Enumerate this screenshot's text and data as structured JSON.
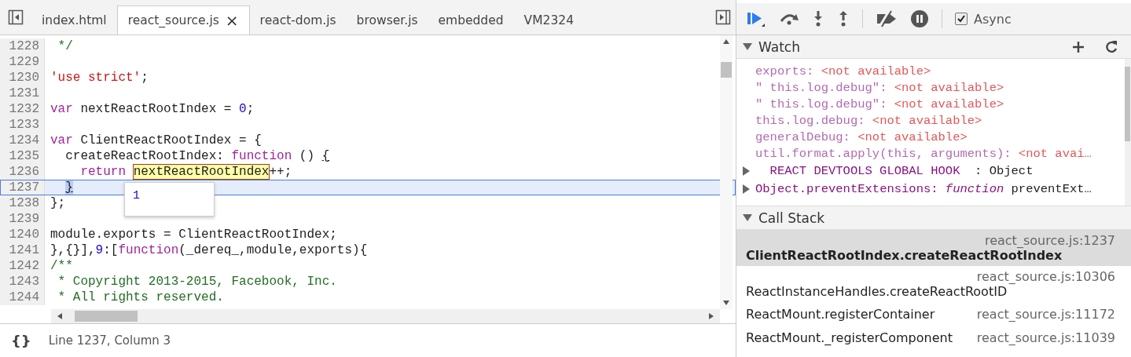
{
  "tabs": [
    {
      "label": "index.html",
      "selected": false,
      "closable": false
    },
    {
      "label": "react_source.js",
      "selected": true,
      "closable": true
    },
    {
      "label": "react-dom.js",
      "selected": false,
      "closable": false
    },
    {
      "label": "browser.js",
      "selected": false,
      "closable": false
    },
    {
      "label": "embedded",
      "selected": false,
      "closable": false
    },
    {
      "label": "VM2324",
      "selected": false,
      "closable": false
    }
  ],
  "close_glyph": "×",
  "editor": {
    "lines": [
      {
        "number": "1228",
        "current": false,
        "tokens": [
          {
            "kind": "comment",
            "text": " */"
          }
        ]
      },
      {
        "number": "1229",
        "current": false
      },
      {
        "number": "1230",
        "current": false,
        "tokens": [
          {
            "kind": "string",
            "text": "'use strict'"
          },
          {
            "kind": "plain",
            "text": ";"
          }
        ]
      },
      {
        "number": "1231",
        "current": false
      },
      {
        "number": "1232",
        "current": false,
        "tokens": [
          {
            "kind": "keyword",
            "text": "var"
          },
          {
            "kind": "plain",
            "text": " nextReactRootIndex = "
          },
          {
            "kind": "number",
            "text": "0"
          },
          {
            "kind": "plain",
            "text": ";"
          }
        ]
      },
      {
        "number": "1233",
        "current": false
      },
      {
        "number": "1234",
        "current": false,
        "tokens": [
          {
            "kind": "keyword",
            "text": "var"
          },
          {
            "kind": "plain",
            "text": " ClientReactRootIndex = {"
          }
        ]
      },
      {
        "number": "1235",
        "current": false,
        "tokens": [
          {
            "kind": "plain",
            "text": "  createReactRootIndex: "
          },
          {
            "kind": "keyword",
            "text": "function"
          },
          {
            "kind": "plain",
            "text": " () "
          },
          {
            "kind": "brace",
            "text": "{"
          }
        ]
      },
      {
        "number": "1236",
        "current": false,
        "tokens": [
          {
            "kind": "keyword",
            "text": "    return "
          },
          {
            "kind": "hovered",
            "text": "nextReactRootIndex"
          },
          {
            "kind": "plain",
            "text": "++;"
          }
        ]
      },
      {
        "number": "1237",
        "current": true,
        "indented": true,
        "tokens": [
          {
            "kind": "brace",
            "text": "}"
          }
        ]
      },
      {
        "number": "1238",
        "current": false,
        "tokens": [
          {
            "kind": "plain",
            "text": "};"
          }
        ]
      },
      {
        "number": "1239",
        "current": false
      },
      {
        "number": "1240",
        "current": false,
        "tokens": [
          {
            "kind": "plain",
            "text": "module.exports = ClientReactRootIndex;"
          }
        ]
      },
      {
        "number": "1241",
        "current": false,
        "tokens": [
          {
            "kind": "plain",
            "text": "},{}],"
          },
          {
            "kind": "number",
            "text": "9"
          },
          {
            "kind": "plain",
            "text": ":["
          },
          {
            "kind": "keyword",
            "text": "function"
          },
          {
            "kind": "plain",
            "text": "(_dereq_,module,exports){"
          }
        ]
      },
      {
        "number": "1242",
        "current": false,
        "tokens": [
          {
            "kind": "comment",
            "text": "/**"
          }
        ]
      },
      {
        "number": "1243",
        "current": false,
        "tokens": [
          {
            "kind": "comment",
            "text": " * Copyright 2013-2015, Facebook, Inc."
          }
        ]
      },
      {
        "number": "1244",
        "current": false,
        "tokens": [
          {
            "kind": "comment",
            "text": " * All rights reserved."
          }
        ]
      }
    ],
    "tooltip": "1"
  },
  "status_bar": {
    "pretty_print": "{}",
    "position": "Line 1237, Column 3"
  },
  "async": {
    "label": "Async",
    "checked": true
  },
  "watch": {
    "title": "Watch",
    "expanded": true,
    "items": [
      {
        "kind": "unavailable",
        "name": "exports:",
        "value": "<not available>"
      },
      {
        "kind": "unavailable",
        "name": "\" this.log.debug\":",
        "value": "<not available>"
      },
      {
        "kind": "unavailable",
        "name": "\" this.log.debug\":",
        "value": "<not available>"
      },
      {
        "kind": "unavailable",
        "name": "this.log.debug:",
        "value": "<not available>"
      },
      {
        "kind": "unavailable",
        "name": "generalDebug:",
        "value": "<not available>"
      },
      {
        "kind": "unavailable",
        "name": "util.format.apply(this, arguments):",
        "value": "<not avai…"
      },
      {
        "kind": "object",
        "name": "REACT DEVTOOLS GLOBAL HOOK",
        "value": ": Object"
      },
      {
        "kind": "function",
        "name": "Object.preventExtensions:",
        "value": "function",
        "detail": "preventExt…"
      }
    ]
  },
  "call_stack": {
    "title": "Call Stack",
    "expanded": true,
    "frames": [
      {
        "function": "ClientReactRootIndex.createReactRootIndex",
        "location": "react_source.js:1237",
        "selected": true,
        "wrapped": true
      },
      {
        "function": "ReactInstanceHandles.createReactRootID",
        "location": "react_source.js:10306",
        "selected": false,
        "wrapped": true
      },
      {
        "function": "ReactMount.registerContainer",
        "location": "react_source.js:11172",
        "selected": false,
        "wrapped": false
      },
      {
        "function": "ReactMount._registerComponent",
        "location": "react_source.js:11039",
        "selected": false,
        "wrapped": false
      }
    ]
  }
}
